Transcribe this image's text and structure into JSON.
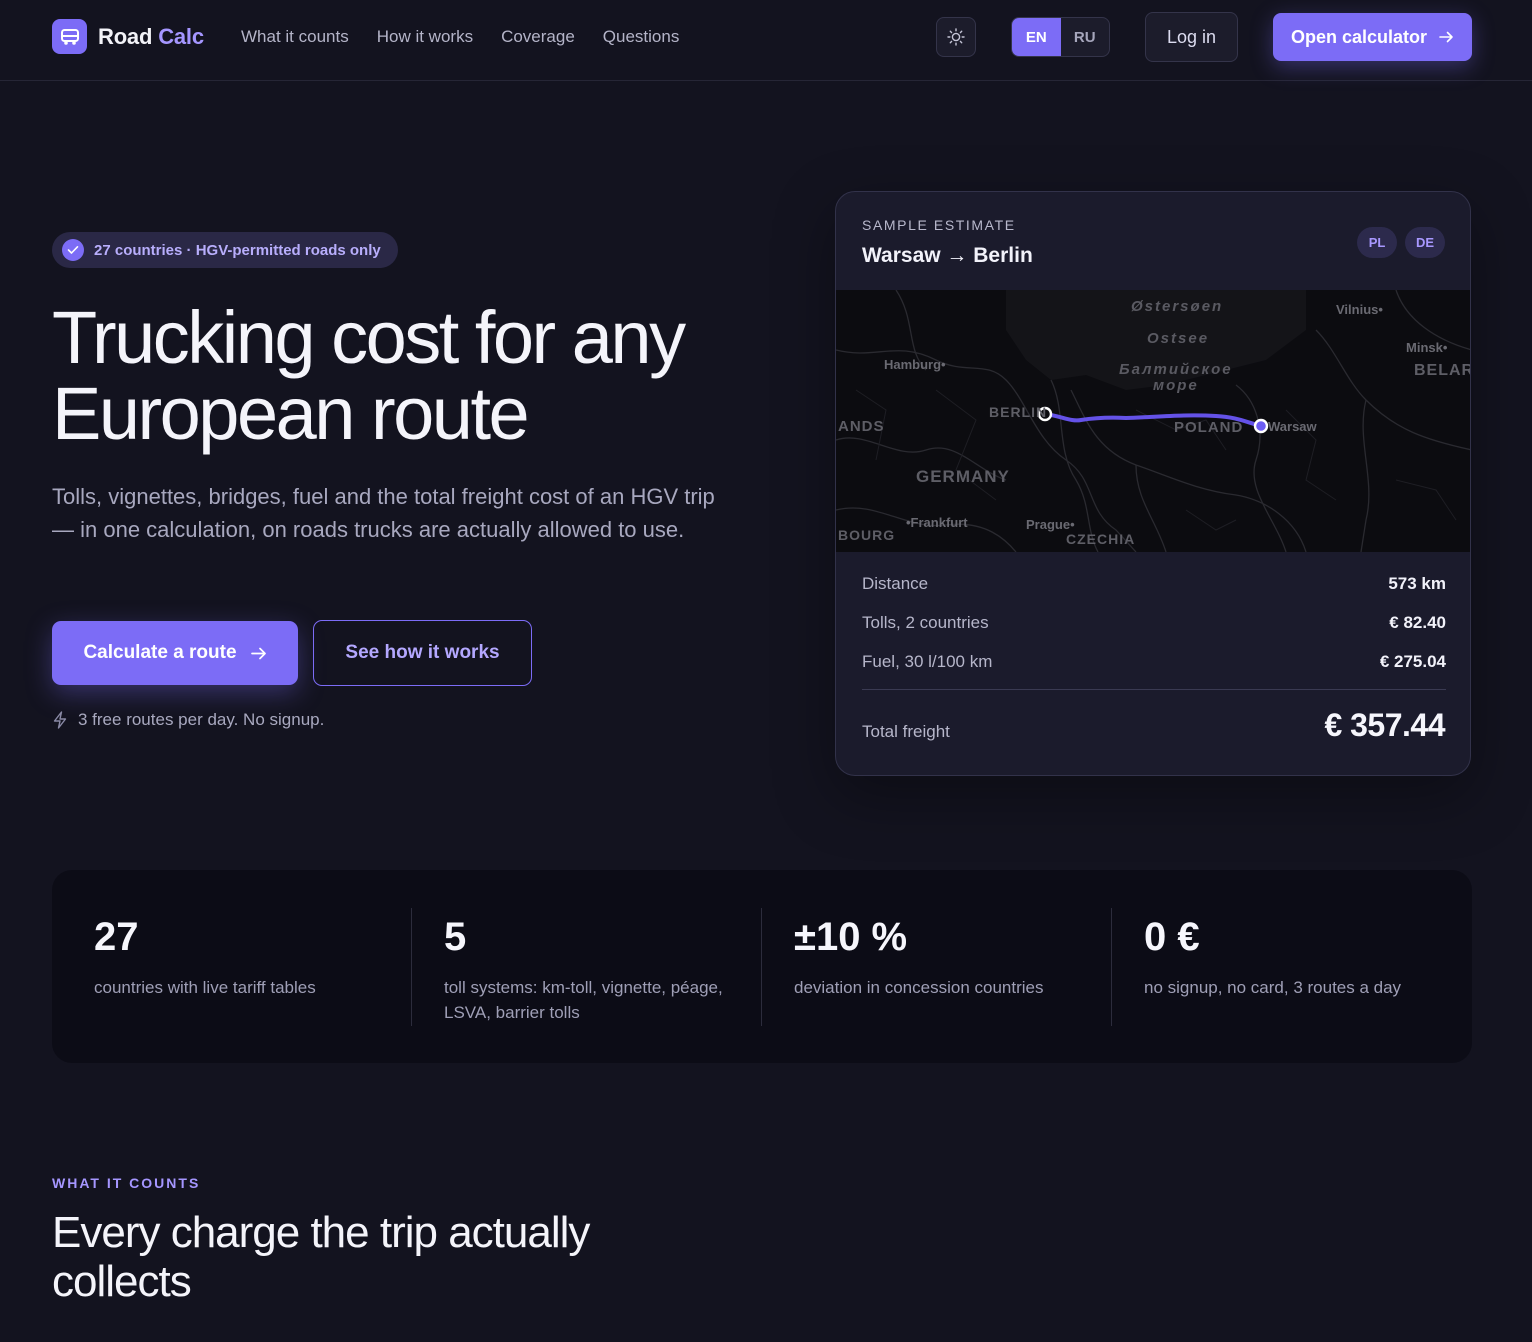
{
  "nav": {
    "logo_word1": "Road",
    "logo_word2": "Calc",
    "links": [
      "What it counts",
      "How it works",
      "Coverage",
      "Questions"
    ],
    "theme_icon": "sun-icon",
    "lang_en": "EN",
    "lang_ru": "RU",
    "lang_active": "EN",
    "login": "Log in",
    "open_calculator": "Open calculator"
  },
  "hero": {
    "badge": "27 countries · HGV-permitted roads only",
    "title_line1": "Trucking cost for any",
    "title_line2": "European route",
    "subtitle": "Tolls, vignettes, bridges, fuel and the total freight cost of an HGV trip — in one calculation, on roads trucks are actually allowed to use.",
    "cta_primary": "Calculate a route",
    "cta_secondary": "See how it works",
    "note": "3 free routes per day. No signup."
  },
  "estimate": {
    "kicker": "SAMPLE ESTIMATE",
    "route": "Warsaw → Berlin",
    "flags": [
      "PL",
      "DE"
    ],
    "map_labels": {
      "sea1": "Østersøen",
      "sea2": "Ostsee",
      "sea3": "Балтийское",
      "sea4": "море",
      "vilnius": "Vilnius•",
      "minsk": "Minsk•",
      "belarus": "BELAR",
      "hamburg": "Hamburg•",
      "berlin": "BERLIN",
      "poland": "POLAND",
      "warsaw": "Warsaw",
      "lands": "ANDS",
      "germany": "GERMANY",
      "frankfurt": "•Frankfurt",
      "prague": "Prague•",
      "czechia": "CZECHIA",
      "bourg": "BOURG"
    },
    "rows": [
      {
        "label": "Distance",
        "value": "573 km"
      },
      {
        "label": "Tolls, 2 countries",
        "value": "€ 82.40"
      },
      {
        "label": "Fuel, 30 l/100 km",
        "value": "€ 275.04"
      }
    ],
    "total_label": "Total freight",
    "total_value": "€ 357.44"
  },
  "stats": [
    {
      "value": "27",
      "label": "countries with live tariff tables"
    },
    {
      "value": "5",
      "label": "toll systems: km-toll, vignette, péage, LSVA, barrier tolls"
    },
    {
      "value": "±10 %",
      "label": "deviation in concession countries"
    },
    {
      "value": "0 €",
      "label": "no signup, no card, 3 routes a day"
    }
  ],
  "section": {
    "kicker": "WHAT IT COUNTS",
    "title": "Every charge the trip actually collects"
  },
  "colors": {
    "background": "#13131f",
    "accent": "#7c6cf6",
    "accent_text": "#a596ff",
    "card": "#1b1b2c"
  }
}
